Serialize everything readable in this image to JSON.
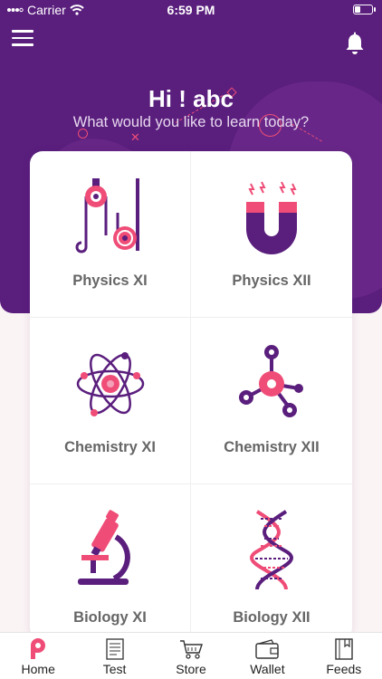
{
  "status_bar": {
    "carrier": "Carrier",
    "time": "6:59 PM"
  },
  "header": {
    "greeting": "Hi ! abc",
    "subtitle": "What would you like to learn today?"
  },
  "courses": [
    {
      "label": "Physics XI",
      "icon": "pulley-icon"
    },
    {
      "label": "Physics XII",
      "icon": "magnet-icon"
    },
    {
      "label": "Chemistry XI",
      "icon": "atom-icon"
    },
    {
      "label": "Chemistry XII",
      "icon": "molecule-icon"
    },
    {
      "label": "Biology XI",
      "icon": "microscope-icon"
    },
    {
      "label": "Biology XII",
      "icon": "dna-icon"
    }
  ],
  "tabs": [
    {
      "label": "Home",
      "icon": "home-logo-icon",
      "active": true
    },
    {
      "label": "Test",
      "icon": "test-sheet-icon"
    },
    {
      "label": "Store",
      "icon": "cart-icon"
    },
    {
      "label": "Wallet",
      "icon": "wallet-icon"
    },
    {
      "label": "Feeds",
      "icon": "book-icon"
    }
  ],
  "colors": {
    "primary": "#5a1e7d",
    "accent": "#ef4d77",
    "accent_light": "#f3a0b8"
  }
}
